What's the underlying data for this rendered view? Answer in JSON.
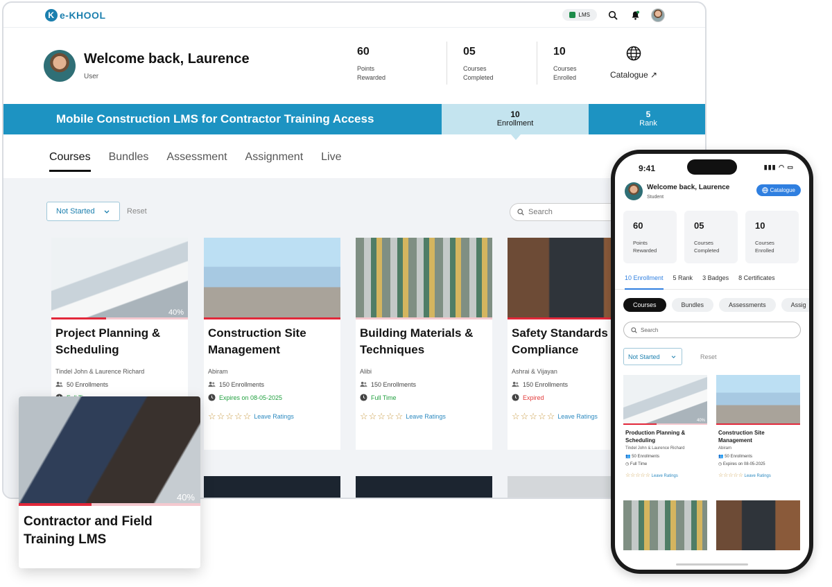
{
  "brand": {
    "logo_text": "e-KHOOL",
    "logo_mark": "K"
  },
  "topbar": {
    "lms_label": "LMS",
    "icons": [
      "search-icon",
      "bell-icon",
      "avatar"
    ]
  },
  "user": {
    "greeting": "Welcome back, Laurence",
    "role": "User",
    "mobile_role": "Student"
  },
  "stats": [
    {
      "value": "60",
      "label": "Points Rewarded"
    },
    {
      "value": "05",
      "label": "Courses Completed"
    },
    {
      "value": "10",
      "label": "Courses Enrolled"
    }
  ],
  "catalogue": {
    "label": "Catalogue ↗",
    "mobile_label": "Catalogue"
  },
  "banner": {
    "title": "Mobile Construction LMS for Contractor Training Access",
    "enrollment_value": "10",
    "enrollment_label": "Enrollment",
    "rank_value": "5",
    "rank_label": "Rank"
  },
  "tabs": [
    "Courses",
    "Bundles",
    "Assessment",
    "Assignment",
    "Live"
  ],
  "filter": {
    "selected": "Not Started",
    "reset": "Reset",
    "search_placeholder": "Search"
  },
  "courses": [
    {
      "title": "Project Planning & Scheduling",
      "author": "Tindel John & Laurence Richard",
      "enrollments": "50 Enrollments",
      "status": "Full Time",
      "progress_pct": 40,
      "progress_label": "40%"
    },
    {
      "title": "Construction Site Management",
      "author": "Abiram",
      "enrollments": "150 Enrollments",
      "status": "Expires on 08-05-2025",
      "progress_pct": 100
    },
    {
      "title": "Building Materials & Techniques",
      "author": "Alibi",
      "enrollments": "150 Enrollments",
      "status": "Full Time",
      "progress_pct": 0
    },
    {
      "title": "Safety Standards Compliance",
      "author": "Ashrai & Vijayan",
      "enrollments": "150 Enrollments",
      "status": "Expired",
      "progress_pct": 100
    }
  ],
  "rating": {
    "stars": "☆☆☆☆☆",
    "label": "Leave Ratings"
  },
  "float_card": {
    "title": "Contractor and Field Training LMS",
    "progress_pct": 40,
    "progress_label": "40%"
  },
  "phone": {
    "time": "9:41",
    "stats": [
      {
        "value": "60",
        "label": "Points Rewarded"
      },
      {
        "value": "05",
        "label": "Courses Completed"
      },
      {
        "value": "10",
        "label": "Courses Enrolled"
      }
    ],
    "tabs": [
      "10 Enrollment",
      "5 Rank",
      "3 Badges",
      "8 Certificates"
    ],
    "pills": [
      "Courses",
      "Bundles",
      "Assessments",
      "Assig"
    ],
    "search_placeholder": "Search",
    "filter": "Not Started",
    "reset": "Reset",
    "cards": [
      {
        "title": "Production Planning & Scheduling",
        "author": "Tindel John & Laurence Richard",
        "enrollments": "50 Enrollments",
        "status": "Full Time",
        "progress_label": "40%",
        "progress_pct": 40
      },
      {
        "title": "Construction Site Management",
        "author": "Abiram",
        "enrollments": "50 Enrollments",
        "status": "Expires on 08-05-2025",
        "progress_pct": 100
      }
    ],
    "rating_label": "Leave Ratings"
  }
}
